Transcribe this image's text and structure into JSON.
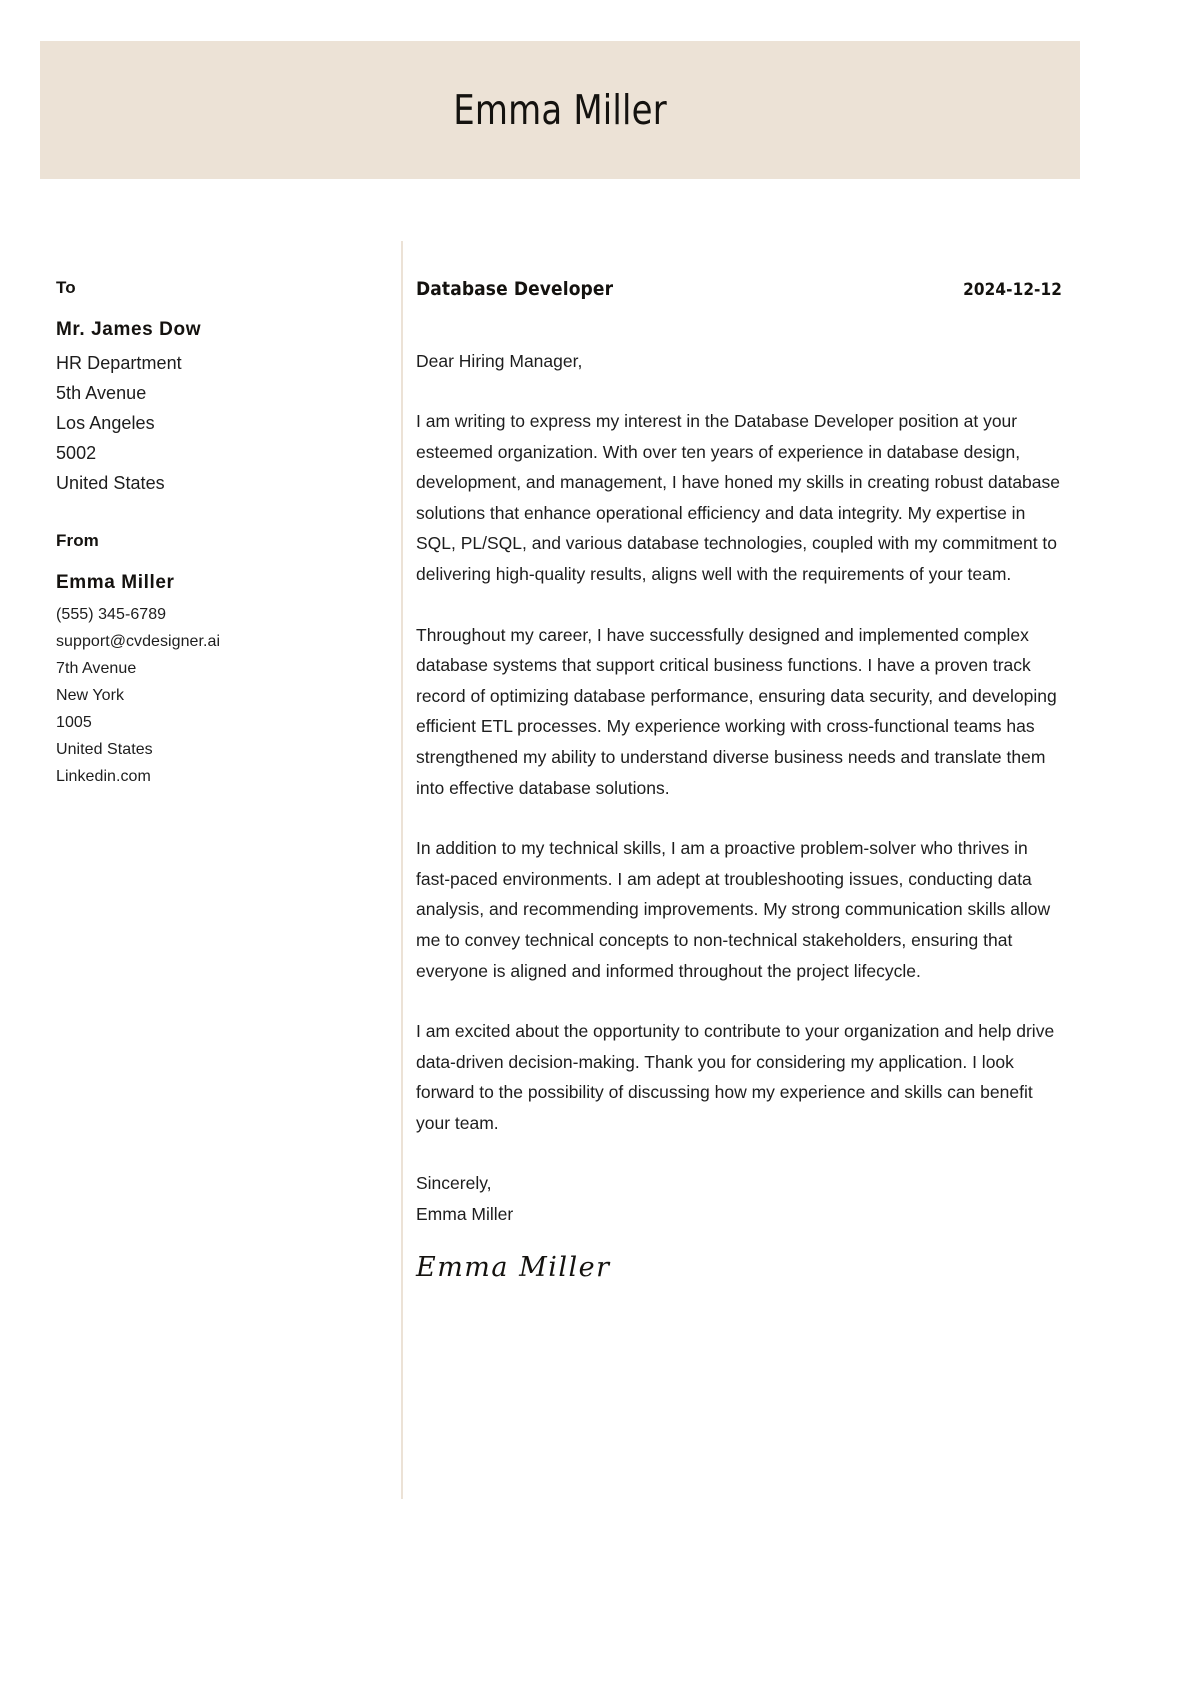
{
  "header": {
    "name": "Emma Miller",
    "band_color": "#ece2d6"
  },
  "sidebar": {
    "to_heading": "To",
    "recipient": {
      "name": "Mr. James Dow",
      "lines": [
        "HR Department",
        "5th Avenue",
        "Los Angeles",
        "5002",
        "United States"
      ]
    },
    "from_heading": "From",
    "sender": {
      "name": "Emma Miller",
      "lines": [
        "(555) 345-6789",
        "support@cvdesigner.ai",
        "7th Avenue",
        "New York",
        "1005",
        "United States",
        "Linkedin.com"
      ]
    }
  },
  "letter": {
    "job_title": "Database Developer",
    "date": "2024-12-12",
    "salutation": "Dear Hiring Manager,",
    "paragraphs": [
      "I am writing to express my interest in the Database Developer position at your esteemed organization. With over ten years of experience in database design, development, and management, I have honed my skills in creating robust database solutions that enhance operational efficiency and data integrity. My expertise in SQL, PL/SQL, and various database technologies, coupled with my commitment to delivering high-quality results, aligns well with the requirements of your team.",
      "Throughout my career, I have successfully designed and implemented complex database systems that support critical business functions. I have a proven track record of optimizing database performance, ensuring data security, and developing efficient ETL processes. My experience working with cross-functional teams has strengthened my ability to understand diverse business needs and translate them into effective database solutions.",
      "In addition to my technical skills, I am a proactive problem-solver who thrives in fast-paced environments. I am adept at troubleshooting issues, conducting data analysis, and recommending improvements. My strong communication skills allow me to convey technical concepts to non-technical stakeholders, ensuring that everyone is aligned and informed throughout the project lifecycle.",
      "I am excited about the opportunity to contribute to your organization and help drive data-driven decision-making. Thank you for considering my application. I look forward to the possibility of discussing how my experience and skills can benefit your team."
    ],
    "closing_word": "Sincerely,",
    "closing_name": "Emma Miller",
    "signature": "Emma Miller"
  }
}
